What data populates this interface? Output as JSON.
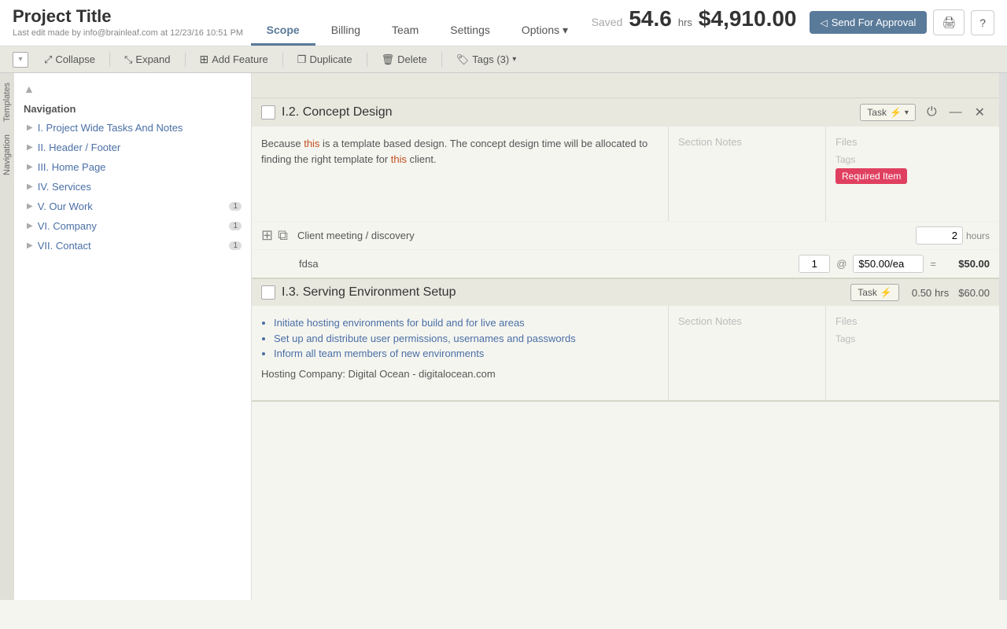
{
  "header": {
    "title": "Project Title",
    "subtitle": "Last edit made by info@brainleaf.com at 12/23/16 10:51 PM",
    "saved": "Saved",
    "hrs": "54.6",
    "hrs_label": "hrs",
    "money": "$4,910.00"
  },
  "tabs": {
    "items": [
      "Scope",
      "Billing",
      "Team",
      "Settings",
      "Options ▾"
    ],
    "active": "Scope"
  },
  "header_actions": {
    "send_approval": "Send For Approval",
    "print": "🖨",
    "help": "?"
  },
  "toolbar": {
    "collapse": "Collapse",
    "expand": "Expand",
    "add_feature": "Add Feature",
    "duplicate": "Duplicate",
    "delete": "Delete",
    "tags": "Tags (3)"
  },
  "sidebar": {
    "title": "Navigation",
    "side_tabs": [
      "Templates",
      "Navigation"
    ],
    "items": [
      {
        "id": "i",
        "label": "I. Project Wide Tasks And Notes",
        "badge": ""
      },
      {
        "id": "ii",
        "label": "II. Header / Footer",
        "badge": ""
      },
      {
        "id": "iii",
        "label": "III. Home Page",
        "badge": ""
      },
      {
        "id": "iv",
        "label": "IV. Services",
        "badge": ""
      },
      {
        "id": "v",
        "label": "V. Our Work",
        "badge": "1"
      },
      {
        "id": "vi",
        "label": "VI. Company",
        "badge": "1"
      },
      {
        "id": "vii",
        "label": "VII. Contact",
        "badge": "1"
      }
    ]
  },
  "feature_i2": {
    "number": "I.2.",
    "title": "Concept Design",
    "task_label": "Task",
    "description": "Because this is a template based design. The concept design time will be allocated to finding the right template for this client.",
    "notes_placeholder": "Section Notes",
    "files_placeholder": "Files",
    "tags_label": "Tags",
    "required_tag": "Required Item",
    "task_row": {
      "label": "Client meeting / discovery",
      "hours_value": "2",
      "hours_label": "hours"
    },
    "item_row": {
      "label": "fdsa",
      "qty": "1",
      "at": "@",
      "price": "$50.00/ea",
      "eq": "=",
      "total": "$50.00"
    }
  },
  "feature_i3": {
    "number": "I.3.",
    "title": "Serving Environment Setup",
    "task_label": "Task",
    "hrs": "0.50",
    "hrs_label": "hrs",
    "money": "$60.00",
    "notes_placeholder": "Section Notes",
    "files_placeholder": "Files",
    "tags_label": "Tags",
    "description_bullets": [
      "Initiate hosting environments for build and for live areas",
      "Set up and distribute user permissions, usernames and passwords",
      "Inform all team members of new environments"
    ],
    "description_footer": "Hosting Company: Digital Ocean - digitalocean.com"
  },
  "colors": {
    "accent_blue": "#5a7a9a",
    "accent_red": "#e04060",
    "nav_link": "#4a6fa5",
    "header_bg": "#e8e8de",
    "tag_bg": "#e04060"
  }
}
